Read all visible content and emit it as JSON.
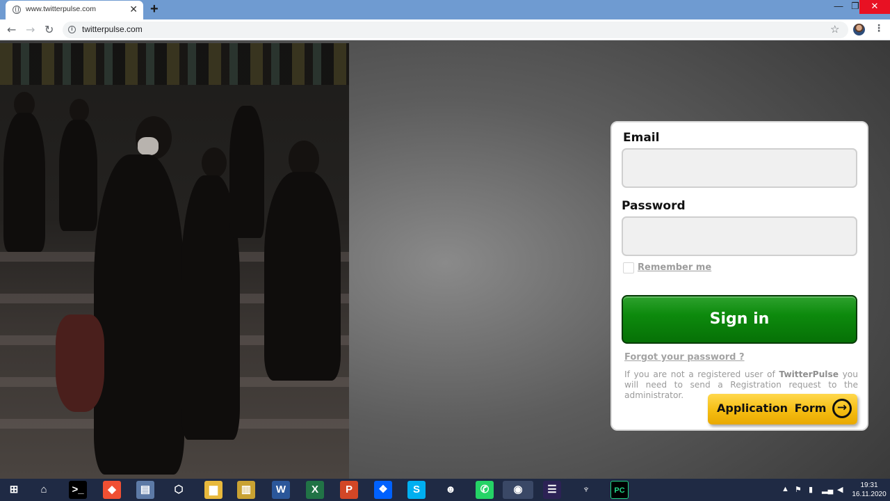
{
  "browser": {
    "tab_title": "www.twitterpulse.com",
    "tab_close": "✕",
    "new_tab": "+",
    "url": "twitterpulse.com",
    "info_icon": "i",
    "window_controls": {
      "minimize": "—",
      "maximize": "❐",
      "close": "✕"
    },
    "nav": {
      "back": "←",
      "forward": "→",
      "reload": "↻"
    },
    "bookmark_icon": "☆",
    "menu_icon": "⋮"
  },
  "login": {
    "email_label": "Email",
    "email_value": "",
    "password_label": "Password",
    "password_value": "",
    "remember_label": "Remember me",
    "remember_checked": false,
    "signin_label": "Sign in",
    "forgot_label": "Forgot your password ?",
    "info_prefix": "If you are not a registered user of ",
    "info_brand": "TwitterPulse",
    "info_suffix": " you will need to send a Registration request to the administrator.",
    "application_form_label": "Application Form",
    "application_form_icon": "arrow-circle-right-icon"
  },
  "taskbar": {
    "apps": [
      {
        "name": "windows-start-icon",
        "glyph": "⊞"
      },
      {
        "name": "home-icon",
        "glyph": "⌂"
      },
      {
        "name": "terminal-icon",
        "glyph": ">_"
      },
      {
        "name": "git-icon",
        "glyph": "◆"
      },
      {
        "name": "network-icon",
        "glyph": "▤"
      },
      {
        "name": "virtualbox-icon",
        "glyph": "⬡"
      },
      {
        "name": "file-explorer-icon",
        "glyph": "▆"
      },
      {
        "name": "archive-icon",
        "glyph": "▥"
      },
      {
        "name": "word-icon",
        "glyph": "W"
      },
      {
        "name": "excel-icon",
        "glyph": "X"
      },
      {
        "name": "powerpoint-icon",
        "glyph": "P"
      },
      {
        "name": "dropbox-icon",
        "glyph": "❖"
      },
      {
        "name": "skype-icon",
        "glyph": "S"
      },
      {
        "name": "discord-icon",
        "glyph": "☻"
      },
      {
        "name": "whatsapp-icon",
        "glyph": "✆"
      },
      {
        "name": "chrome-icon",
        "glyph": "◉"
      },
      {
        "name": "eclipse-icon",
        "glyph": "☰"
      },
      {
        "name": "mysql-workbench-icon",
        "glyph": "♆"
      },
      {
        "name": "pycharm-icon",
        "glyph": "PC"
      }
    ],
    "time": "19:31",
    "date": "16.11.2020"
  }
}
